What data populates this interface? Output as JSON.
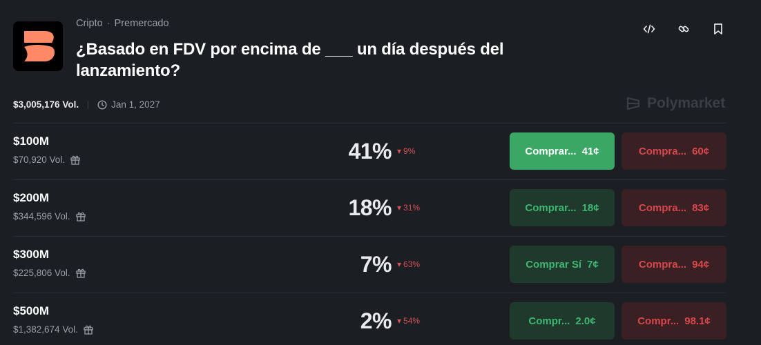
{
  "header": {
    "category": "Cripto",
    "separator": "·",
    "subcategory": "Premercado",
    "title": "¿Basado en FDV por encima de ___ un día después del lanzamiento?"
  },
  "meta": {
    "volume": "$3,005,176 Vol.",
    "end_date": "Jan 1, 2027"
  },
  "brand": "Polymarket",
  "icons": [
    "code-icon",
    "link-icon",
    "bookmark-icon",
    "clock-icon",
    "gift-icon"
  ],
  "colors": {
    "background": "#1b1e23",
    "yes_active": "#3aa864",
    "yes_text": "#3fb772",
    "no_text": "#d9474c",
    "logo_accent": "#ff8a65"
  },
  "markets": [
    {
      "label": "$100M",
      "volume": "$70,920 Vol.",
      "probability": "41%",
      "change": "9%",
      "yes_label": "Comprar...",
      "yes_price": "41¢",
      "no_label": "Compra...",
      "no_price": "60¢"
    },
    {
      "label": "$200M",
      "volume": "$344,596 Vol.",
      "probability": "18%",
      "change": "31%",
      "yes_label": "Comprar...",
      "yes_price": "18¢",
      "no_label": "Compra...",
      "no_price": "83¢"
    },
    {
      "label": "$300M",
      "volume": "$225,806 Vol.",
      "probability": "7%",
      "change": "63%",
      "yes_label": "Comprar Sí",
      "yes_price": "7¢",
      "no_label": "Compra...",
      "no_price": "94¢"
    },
    {
      "label": "$500M",
      "volume": "$1,382,674 Vol.",
      "probability": "2%",
      "change": "54%",
      "yes_label": "Compr...",
      "yes_price": "2.0¢",
      "no_label": "Compr...",
      "no_price": "98.1¢"
    }
  ]
}
